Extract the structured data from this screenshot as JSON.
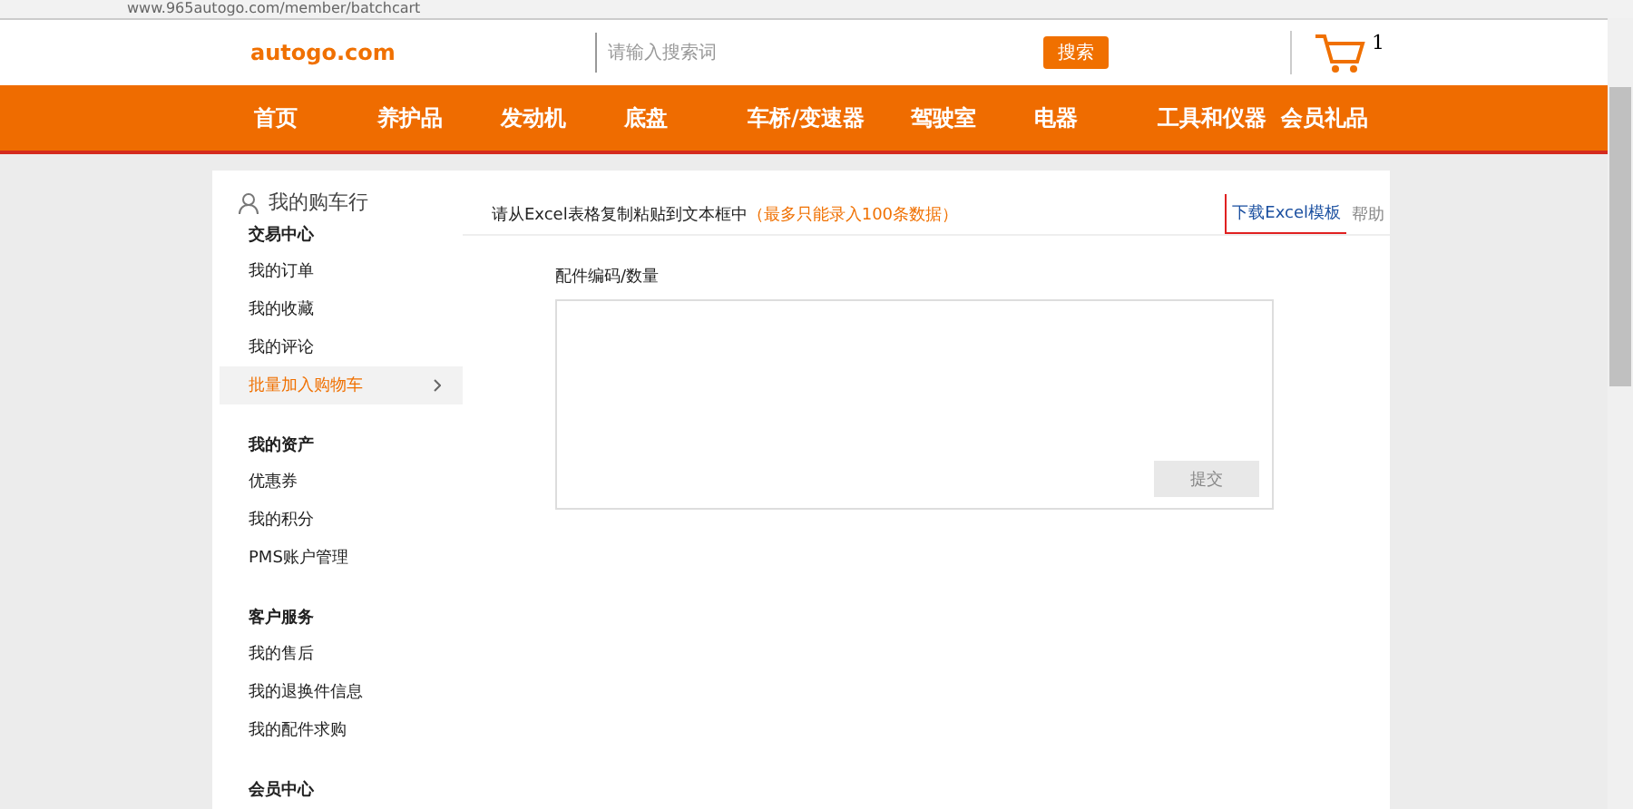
{
  "browser": {
    "url": "www.965autogo.com/member/batchcart"
  },
  "header": {
    "logo_text": "autogo.com",
    "search_placeholder": "请输入搜索词",
    "search_button": "搜索",
    "cart_count": "1"
  },
  "nav": [
    "首页",
    "养护品",
    "发动机",
    "底盘",
    "车桥/变速器",
    "驾驶室",
    "电器",
    "工具和仪器",
    "会员礼品"
  ],
  "sidebar": {
    "title": "我的购车行",
    "groups": [
      {
        "heading": "交易中心",
        "items": [
          {
            "label": "我的订单",
            "selected": false
          },
          {
            "label": "我的收藏",
            "selected": false
          },
          {
            "label": "我的评论",
            "selected": false
          },
          {
            "label": "批量加入购物车",
            "selected": true
          }
        ]
      },
      {
        "heading": "我的资产",
        "items": [
          {
            "label": "优惠券",
            "selected": false
          },
          {
            "label": "我的积分",
            "selected": false
          },
          {
            "label": "PMS账户管理",
            "selected": false
          }
        ]
      },
      {
        "heading": "客户服务",
        "items": [
          {
            "label": "我的售后",
            "selected": false
          },
          {
            "label": "我的退换件信息",
            "selected": false
          },
          {
            "label": "我的配件求购",
            "selected": false
          }
        ]
      },
      {
        "heading": "会员中心"
      }
    ]
  },
  "main": {
    "instruction": "请从Excel表格复制粘贴到文本框中",
    "limit_note": "（最多只能录入100条数据）",
    "tabs": [
      {
        "label": "下载Excel模板",
        "selected": true
      },
      {
        "label": "帮助",
        "selected": false
      }
    ],
    "field_label": "配件编码/数量",
    "submit_button": {
      "label": "提交",
      "disabled": true
    }
  }
}
